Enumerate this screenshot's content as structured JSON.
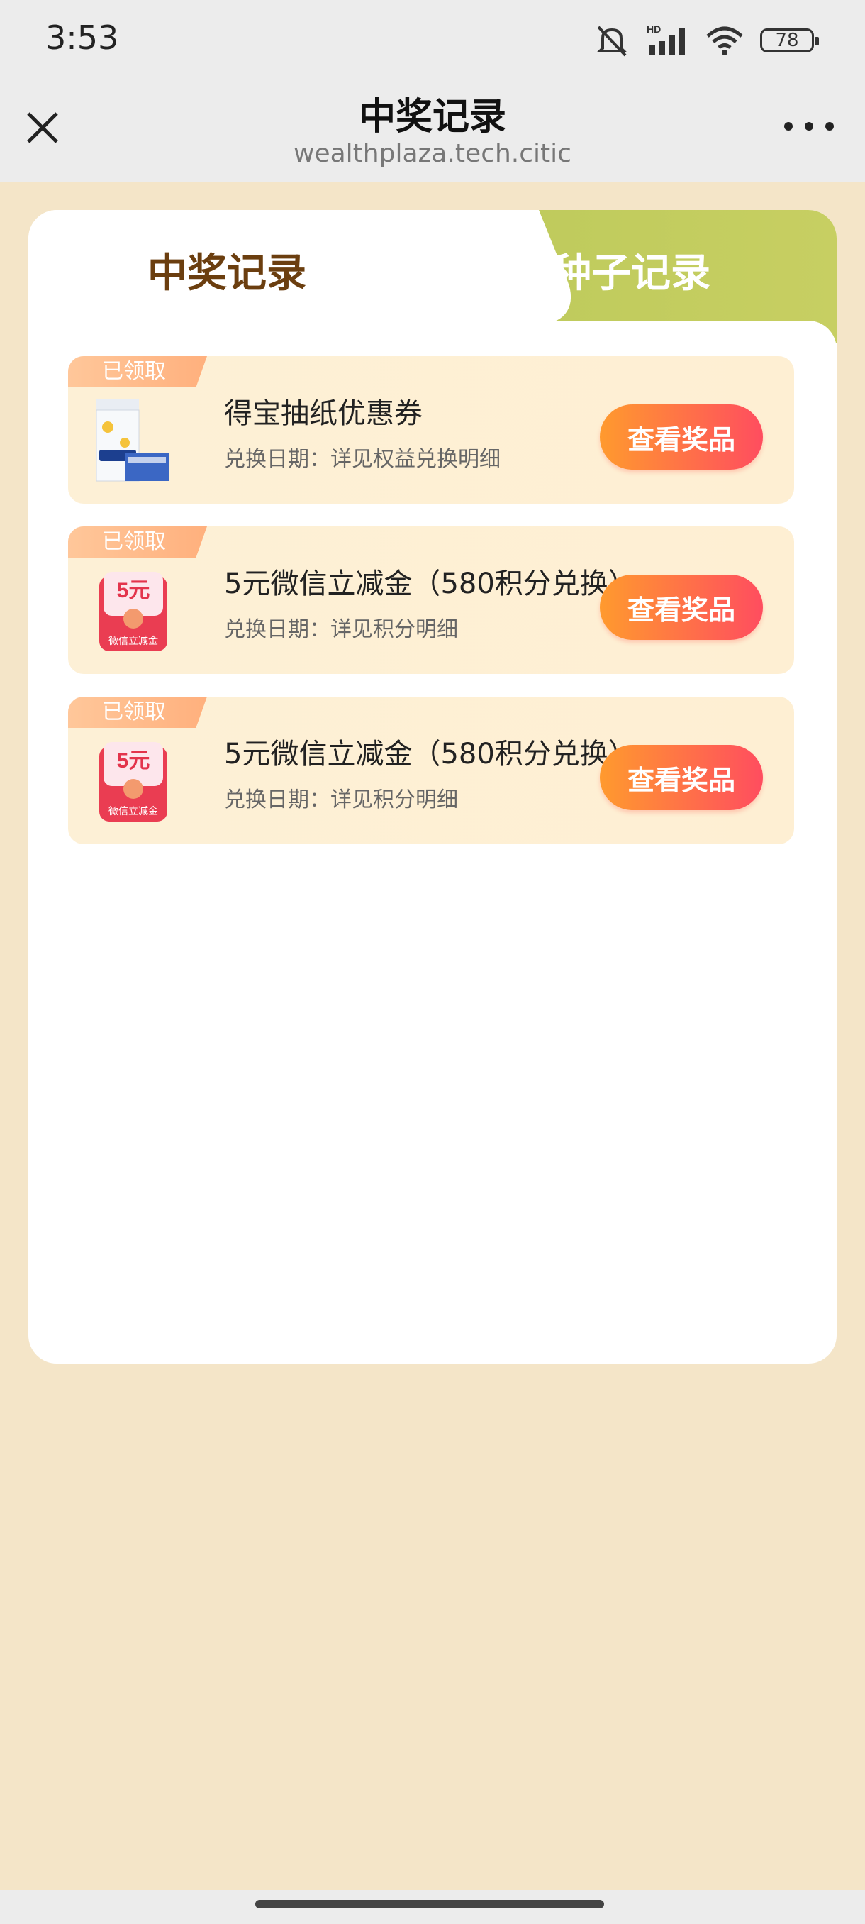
{
  "status_bar": {
    "time": "3:53",
    "battery": "78",
    "network": "HD"
  },
  "header": {
    "title": "中奖记录",
    "subtitle": "wealthplaza.tech.citic"
  },
  "tabs": [
    {
      "label": "中奖记录",
      "active": true
    },
    {
      "label": "种子记录",
      "active": false
    }
  ],
  "records": [
    {
      "badge": "已领取",
      "title": "得宝抽纸优惠券",
      "subtitle": "兑换日期：详见权益兑换明细",
      "button": "查看奖品",
      "image": "tissue-pack"
    },
    {
      "badge": "已领取",
      "title": "5元微信立减金（580积分兑换）",
      "subtitle": "兑换日期：详见积分明细",
      "button": "查看奖品",
      "image": "red-envelope",
      "image_text": "5元",
      "image_caption": "微信立减金"
    },
    {
      "badge": "已领取",
      "title": "5元微信立减金（580积分兑换）",
      "subtitle": "兑换日期：详见积分明细",
      "button": "查看奖品",
      "image": "red-envelope",
      "image_text": "5元",
      "image_caption": "微信立减金"
    }
  ],
  "colors": {
    "page_bg": "#f4e5c8",
    "tab_inactive": "#c2cb5e",
    "tab_active_text": "#6b3e0f",
    "button_start": "#ff9a2e",
    "button_end": "#ff4d5f"
  }
}
